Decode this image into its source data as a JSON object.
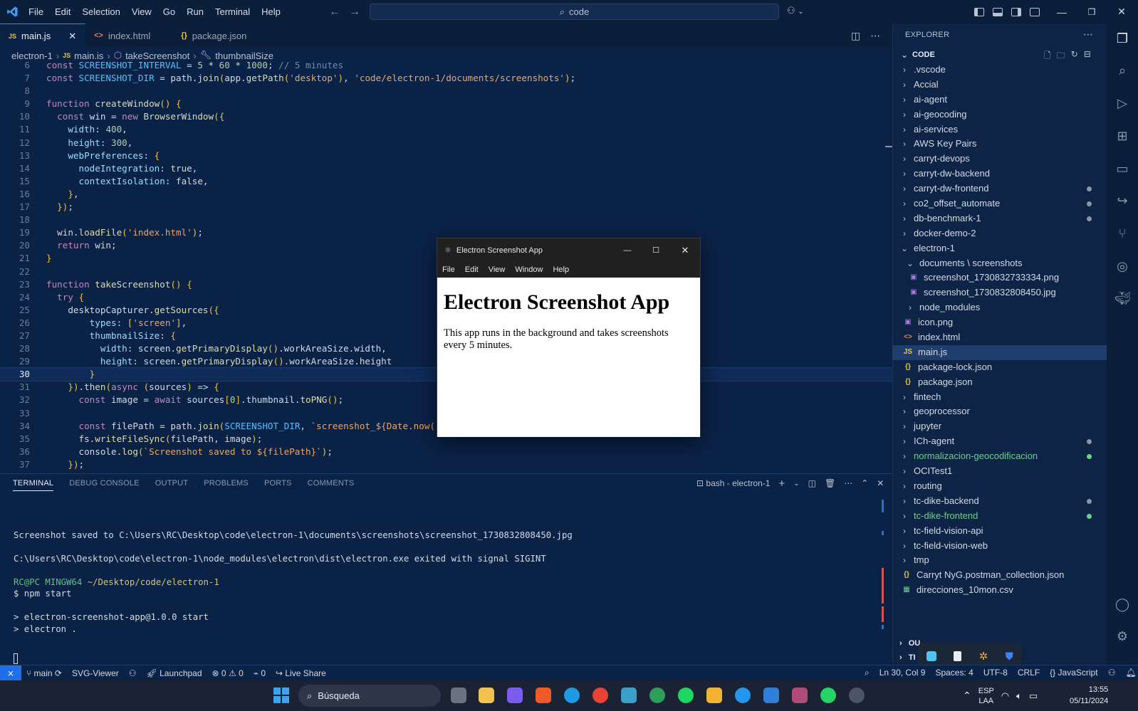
{
  "titlebar": {
    "menu": [
      "File",
      "Edit",
      "Selection",
      "View",
      "Go",
      "Run",
      "Terminal",
      "Help"
    ],
    "command_center": "code"
  },
  "tabs": [
    {
      "label": "main.js",
      "icon": "JS",
      "active": true
    },
    {
      "label": "index.html",
      "icon": "<>",
      "active": false
    },
    {
      "label": "package.json",
      "icon": "{}",
      "active": false
    }
  ],
  "breadcrumb": [
    "electron-1",
    "main.js",
    "takeScreenshot",
    "thumbnailSize"
  ],
  "code": {
    "current_line": 30,
    "lines": [
      {
        "n": "6",
        "t": "const SCREENSHOT_INTERVAL = 5 * 60 * 1000; // 5 minutes"
      },
      {
        "n": "7",
        "t": "const SCREENSHOT_DIR = path.join(app.getPath('desktop'), 'code/electron-1/documents/screenshots');"
      },
      {
        "n": "8",
        "t": ""
      },
      {
        "n": "9",
        "t": "function createWindow() {"
      },
      {
        "n": "10",
        "t": "  const win = new BrowserWindow({"
      },
      {
        "n": "11",
        "t": "    width: 400,"
      },
      {
        "n": "12",
        "t": "    height: 300,"
      },
      {
        "n": "13",
        "t": "    webPreferences: {"
      },
      {
        "n": "14",
        "t": "      nodeIntegration: true,"
      },
      {
        "n": "15",
        "t": "      contextIsolation: false,"
      },
      {
        "n": "16",
        "t": "    },"
      },
      {
        "n": "17",
        "t": "  });"
      },
      {
        "n": "18",
        "t": ""
      },
      {
        "n": "19",
        "t": "  win.loadFile('index.html');"
      },
      {
        "n": "20",
        "t": "  return win;"
      },
      {
        "n": "21",
        "t": "}"
      },
      {
        "n": "22",
        "t": ""
      },
      {
        "n": "23",
        "t": "function takeScreenshot() {"
      },
      {
        "n": "24",
        "t": "  try {"
      },
      {
        "n": "25",
        "t": "    desktopCapturer.getSources({"
      },
      {
        "n": "26",
        "t": "        types: ['screen'],"
      },
      {
        "n": "27",
        "t": "        thumbnailSize: {"
      },
      {
        "n": "28",
        "t": "          width: screen.getPrimaryDisplay().workAreaSize.width,"
      },
      {
        "n": "29",
        "t": "          height: screen.getPrimaryDisplay().workAreaSize.height"
      },
      {
        "n": "30",
        "t": "        }"
      },
      {
        "n": "31",
        "t": "    }).then(async (sources) => {"
      },
      {
        "n": "32",
        "t": "      const image = await sources[0].thumbnail.toPNG();"
      },
      {
        "n": "33",
        "t": ""
      },
      {
        "n": "34",
        "t": "      const filePath = path.join(SCREENSHOT_DIR, `screenshot_${Date.now()}.jpg`);"
      },
      {
        "n": "35",
        "t": "      fs.writeFileSync(filePath, image);"
      },
      {
        "n": "36",
        "t": "      console.log(`Screenshot saved to ${filePath}`);"
      },
      {
        "n": "37",
        "t": "    });"
      }
    ]
  },
  "panel": {
    "tabs": [
      "TERMINAL",
      "DEBUG CONSOLE",
      "OUTPUT",
      "PROBLEMS",
      "PORTS",
      "COMMENTS"
    ],
    "terminal_name": "bash - electron-1",
    "terminal_lines": [
      {
        "t": "",
        "c": ""
      },
      {
        "t": "Screenshot saved to C:\\Users\\RC\\Desktop\\code\\electron-1\\documents\\screenshots\\screenshot_1730832808450.jpg",
        "c": ""
      },
      {
        "t": "",
        "c": ""
      },
      {
        "t": "C:\\Users\\RC\\Desktop\\code\\electron-1\\node_modules\\electron\\dist\\electron.exe exited with signal SIGINT",
        "c": ""
      },
      {
        "t": "",
        "c": ""
      },
      {
        "t": "RC@PC MINGW64 ~/Desktop/code/electron-1",
        "c": "prompt"
      },
      {
        "t": "$ npm start",
        "c": ""
      },
      {
        "t": "",
        "c": ""
      },
      {
        "t": "> electron-screenshot-app@1.0.0 start",
        "c": ""
      },
      {
        "t": "> electron .",
        "c": ""
      }
    ]
  },
  "explorer": {
    "title": "EXPLORER",
    "section": "CODE",
    "items": [
      {
        "label": ".vscode",
        "type": "folder",
        "depth": 0,
        "open": false,
        "dot": false,
        "modified": false
      },
      {
        "label": "Accial",
        "type": "folder",
        "depth": 0,
        "open": false,
        "dot": false,
        "modified": false
      },
      {
        "label": "ai-agent",
        "type": "folder",
        "depth": 0,
        "open": false,
        "dot": false,
        "modified": false
      },
      {
        "label": "ai-geocoding",
        "type": "folder",
        "depth": 0,
        "open": false,
        "dot": false,
        "modified": false
      },
      {
        "label": "ai-services",
        "type": "folder",
        "depth": 0,
        "open": false,
        "dot": false,
        "modified": false
      },
      {
        "label": "AWS Key Pairs",
        "type": "folder",
        "depth": 0,
        "open": false,
        "dot": false,
        "modified": false
      },
      {
        "label": "carryt-devops",
        "type": "folder",
        "depth": 0,
        "open": false,
        "dot": false,
        "modified": false
      },
      {
        "label": "carryt-dw-backend",
        "type": "folder",
        "depth": 0,
        "open": false,
        "dot": false,
        "modified": false
      },
      {
        "label": "carryt-dw-frontend",
        "type": "folder",
        "depth": 0,
        "open": false,
        "dot": true,
        "modified": false
      },
      {
        "label": "co2_offset_automate",
        "type": "folder",
        "depth": 0,
        "open": false,
        "dot": true,
        "modified": false
      },
      {
        "label": "db-benchmark-1",
        "type": "folder",
        "depth": 0,
        "open": false,
        "dot": true,
        "modified": false
      },
      {
        "label": "docker-demo-2",
        "type": "folder",
        "depth": 0,
        "open": false,
        "dot": false,
        "modified": false
      },
      {
        "label": "electron-1",
        "type": "folder",
        "depth": 0,
        "open": true,
        "dot": false,
        "modified": false
      },
      {
        "label": "documents \\ screenshots",
        "type": "folder",
        "depth": 1,
        "open": true,
        "dot": false,
        "modified": false
      },
      {
        "label": "screenshot_1730832733334.png",
        "type": "image",
        "depth": 2,
        "open": false,
        "dot": false,
        "modified": false
      },
      {
        "label": "screenshot_1730832808450.jpg",
        "type": "image",
        "depth": 2,
        "open": false,
        "dot": false,
        "modified": false
      },
      {
        "label": "node_modules",
        "type": "folder",
        "depth": 1,
        "open": false,
        "dot": false,
        "modified": false
      },
      {
        "label": "icon.png",
        "type": "image",
        "depth": 1,
        "open": false,
        "dot": false,
        "modified": false
      },
      {
        "label": "index.html",
        "type": "html",
        "depth": 1,
        "open": false,
        "dot": false,
        "modified": false
      },
      {
        "label": "main.js",
        "type": "js",
        "depth": 1,
        "open": false,
        "dot": false,
        "modified": false,
        "selected": true
      },
      {
        "label": "package-lock.json",
        "type": "json",
        "depth": 1,
        "open": false,
        "dot": false,
        "modified": false
      },
      {
        "label": "package.json",
        "type": "json",
        "depth": 1,
        "open": false,
        "dot": false,
        "modified": false
      },
      {
        "label": "fintech",
        "type": "folder",
        "depth": 0,
        "open": false,
        "dot": false,
        "modified": false
      },
      {
        "label": "geoprocessor",
        "type": "folder",
        "depth": 0,
        "open": false,
        "dot": false,
        "modified": false
      },
      {
        "label": "jupyter",
        "type": "folder",
        "depth": 0,
        "open": false,
        "dot": false,
        "modified": false
      },
      {
        "label": "ICh-agent",
        "type": "folder",
        "depth": 0,
        "open": false,
        "dot": true,
        "modified": false
      },
      {
        "label": "normalizacion-geocodificacion",
        "type": "folder",
        "depth": 0,
        "open": false,
        "dot": true,
        "modified": true
      },
      {
        "label": "OCITest1",
        "type": "folder",
        "depth": 0,
        "open": false,
        "dot": false,
        "modified": false
      },
      {
        "label": "routing",
        "type": "folder",
        "depth": 0,
        "open": false,
        "dot": false,
        "modified": false
      },
      {
        "label": "tc-dike-backend",
        "type": "folder",
        "depth": 0,
        "open": false,
        "dot": true,
        "modified": false
      },
      {
        "label": "tc-dike-frontend",
        "type": "folder",
        "depth": 0,
        "open": false,
        "dot": true,
        "modified": true
      },
      {
        "label": "tc-field-vision-api",
        "type": "folder",
        "depth": 0,
        "open": false,
        "dot": false,
        "modified": false
      },
      {
        "label": "tc-field-vision-web",
        "type": "folder",
        "depth": 0,
        "open": false,
        "dot": false,
        "modified": false
      },
      {
        "label": "tmp",
        "type": "folder",
        "depth": 0,
        "open": false,
        "dot": false,
        "modified": false
      },
      {
        "label": "Carryt NyG.postman_collection.json",
        "type": "json",
        "depth": -1,
        "open": false,
        "dot": false,
        "modified": false
      },
      {
        "label": "direcciones_10mon.csv",
        "type": "csv",
        "depth": -1,
        "open": false,
        "dot": false,
        "modified": false
      }
    ],
    "outline_label": "OU",
    "timeline_label": "TI"
  },
  "statusbar": {
    "branch": "main",
    "svg_viewer": "SVG-Viewer",
    "launchpad": "Launchpad",
    "errors": "0",
    "warnings": "0",
    "ports": "0",
    "live_share": "Live Share",
    "cursor": "Ln 30, Col 9",
    "spaces": "Spaces: 4",
    "encoding": "UTF-8",
    "eol": "CRLF",
    "language": "JavaScript"
  },
  "taskbar": {
    "search": "Búsqueda",
    "lang1": "ESP",
    "lang2": "LAA",
    "time": "13:55",
    "date": "05/11/2024"
  },
  "electron_window": {
    "title": "Electron Screenshot App",
    "menu": [
      "File",
      "Edit",
      "View",
      "Window",
      "Help"
    ],
    "heading": "Electron Screenshot App",
    "paragraph": "This app runs in the background and takes screenshots every 5 minutes."
  }
}
